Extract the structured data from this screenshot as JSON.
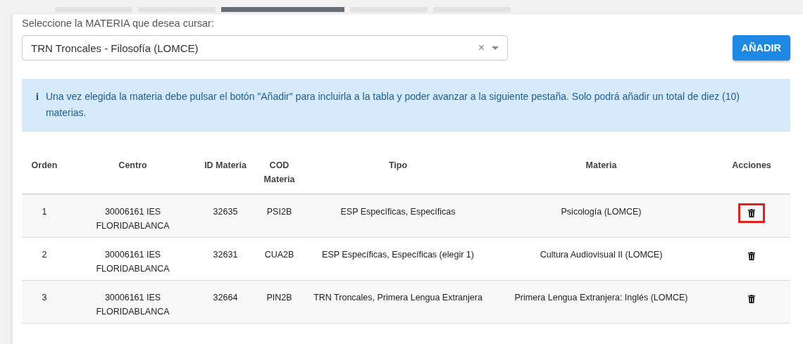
{
  "tabs": [
    {
      "selected": false
    },
    {
      "selected": false
    },
    {
      "selected": true
    },
    {
      "selected": false
    },
    {
      "selected": false
    }
  ],
  "subject_select": {
    "label": "Seleccione la MATERIA que desea cursar:",
    "value": "TRN Troncales - Filosofía (LOMCE)",
    "clear": "×"
  },
  "add_button": "AÑADIR",
  "info_alert": {
    "icon": "i",
    "text": "Una vez elegida la materia debe pulsar el botón \"Añadir\" para incluirla a la tabla y poder avanzar a la siguiente pestaña. Solo podrá añadir un total de diez (10) materias."
  },
  "table": {
    "columns": [
      "Orden",
      "Centro",
      "ID Materia",
      "COD Materia",
      "Tipo",
      "Materia",
      "Acciones"
    ],
    "rows": [
      {
        "orden": "1",
        "centro": "30006161 IES FLORIDABLANCA",
        "id": "32635",
        "cod": "PSI2B",
        "tipo": "ESP Específicas, Específicas",
        "materia": "Psicología (LOMCE)",
        "highlighted": true
      },
      {
        "orden": "2",
        "centro": "30006161 IES FLORIDABLANCA",
        "id": "32631",
        "cod": "CUA2B",
        "tipo": "ESP Específicas, Específicas (elegir 1)",
        "materia": "Cultura Audiovisual II (LOMCE)",
        "highlighted": false
      },
      {
        "orden": "3",
        "centro": "30006161 IES FLORIDABLANCA",
        "id": "32664",
        "cod": "PIN2B",
        "tipo": "TRN Troncales, Primera Lengua Extranjera",
        "materia": "Primera Lengua Extranjera: Inglés (LOMCE)",
        "highlighted": false
      }
    ]
  }
}
